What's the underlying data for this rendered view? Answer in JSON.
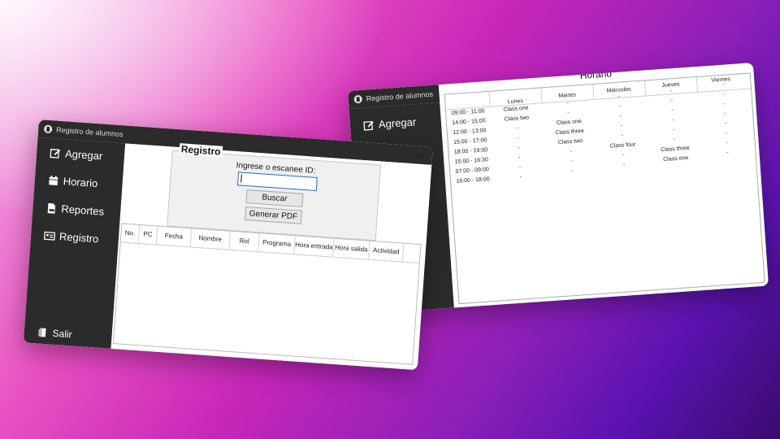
{
  "colors": {
    "sidebar": "#2b2b2b",
    "accent": "#1e6fd9",
    "panel": "#f0f0f0"
  },
  "window_left": {
    "title": "Registro de alumnos",
    "controls": {
      "minimize": "–",
      "maximize": "□",
      "close": "✕"
    },
    "sidebar": {
      "items": [
        {
          "label": "Agregar",
          "icon": "edit-icon"
        },
        {
          "label": "Horario",
          "icon": "calendar-icon"
        },
        {
          "label": "Reportes",
          "icon": "pdf-document-icon"
        },
        {
          "label": "Registro",
          "icon": "id-card-icon"
        }
      ],
      "exit": {
        "label": "Salir",
        "icon": "exit-door-icon"
      }
    },
    "registro": {
      "title": "Registro",
      "prompt": "Ingrese o escanee ID:",
      "id_value": "",
      "search_button": "Buscar",
      "pdf_button": "Generar PDF"
    },
    "table": {
      "columns": [
        "No.",
        "PC",
        "Fecha",
        "Nombre",
        "Rol",
        "Programa",
        "Hora entrada",
        "Hora salida",
        "Actividad"
      ]
    }
  },
  "window_right": {
    "title": "Registro de alumnos",
    "controls": {
      "minimize": "–",
      "maximize": "□",
      "close": "✕"
    },
    "sidebar": {
      "items": [
        {
          "label": "Agregar",
          "icon": "edit-icon"
        }
      ]
    },
    "schedule": {
      "title": "Horario",
      "days": [
        "Lunes",
        "Martes",
        "Miércoles",
        "Jueves",
        "Viernes"
      ],
      "times": [
        "09:00 - 11:00",
        "14:00 - 15:00",
        "12:00 - 13:00",
        "15:00 - 17:00",
        "18:00 - 19:00",
        "15:00 - 16:30",
        "07:00 - 09:00",
        "16:00 - 18:00"
      ],
      "grid": [
        [
          "Class one",
          "-",
          "-",
          "-",
          "-"
        ],
        [
          "Class two",
          "-",
          "-",
          "-",
          "-"
        ],
        [
          "-",
          "Class one",
          "-",
          "-",
          "-"
        ],
        [
          "-",
          "Class three",
          "-",
          "-",
          "-"
        ],
        [
          "-",
          "Class two",
          "-",
          "-",
          "-"
        ],
        [
          "-",
          "-",
          "Class four",
          "-",
          "-"
        ],
        [
          "-",
          "-",
          "-",
          "Class three",
          "-"
        ],
        [
          "-",
          "-",
          "-",
          "Class one",
          "-"
        ]
      ]
    }
  }
}
